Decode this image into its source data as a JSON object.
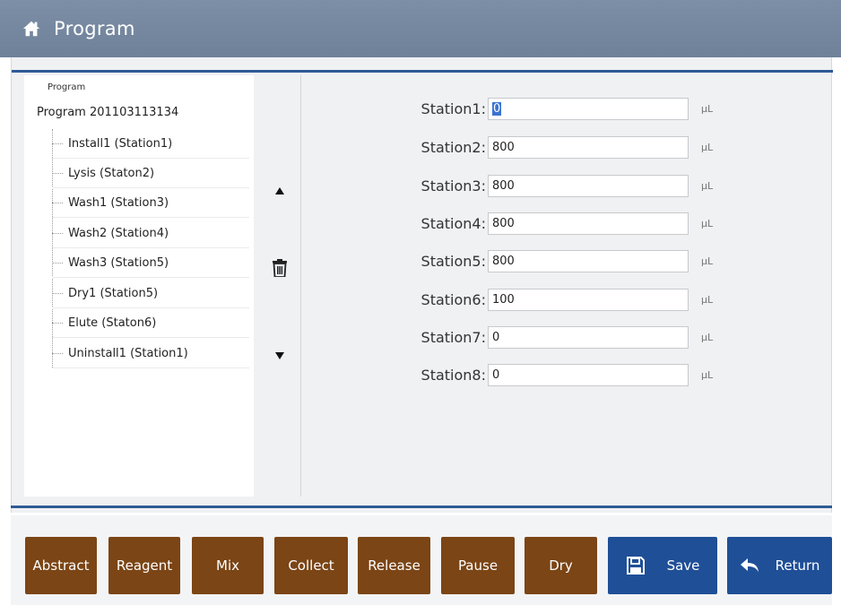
{
  "window": {
    "title": "Program",
    "icon": "home-icon"
  },
  "tree": {
    "root_label": "Program",
    "program_name": "Program 201103113134",
    "items": [
      {
        "label": "Install1 (Station1)"
      },
      {
        "label": "Lysis (Staton2)"
      },
      {
        "label": "Wash1 (Station3)"
      },
      {
        "label": "Wash2 (Station4)"
      },
      {
        "label": "Wash3 (Station5)"
      },
      {
        "label": "Dry1 (Station5)"
      },
      {
        "label": "Elute (Staton6)"
      },
      {
        "label": "Uninstall1 (Station1)"
      }
    ]
  },
  "tools": {
    "up": "triangle-up-icon",
    "delete": "trash-icon",
    "down": "triangle-down-icon"
  },
  "params": {
    "unit": "μL",
    "stations": [
      {
        "label": "Station1:",
        "value": "0"
      },
      {
        "label": "Station2:",
        "value": "800"
      },
      {
        "label": "Station3:",
        "value": "800"
      },
      {
        "label": "Station4:",
        "value": "800"
      },
      {
        "label": "Station5:",
        "value": "800"
      },
      {
        "label": "Station6:",
        "value": "100"
      },
      {
        "label": "Station7:",
        "value": "0"
      },
      {
        "label": "Station8:",
        "value": "0"
      }
    ]
  },
  "footer": {
    "buttons": [
      {
        "label": "Abstract"
      },
      {
        "label": "Reagent"
      },
      {
        "label": "Mix"
      },
      {
        "label": "Collect"
      },
      {
        "label": "Release"
      },
      {
        "label": "Pause"
      },
      {
        "label": "Dry"
      }
    ],
    "save_label": "Save",
    "return_label": "Return"
  },
  "colors": {
    "header": "#7387a0",
    "accent_line": "#2e5b96",
    "step_button": "#7b4515",
    "action_button": "#1f4f97"
  }
}
